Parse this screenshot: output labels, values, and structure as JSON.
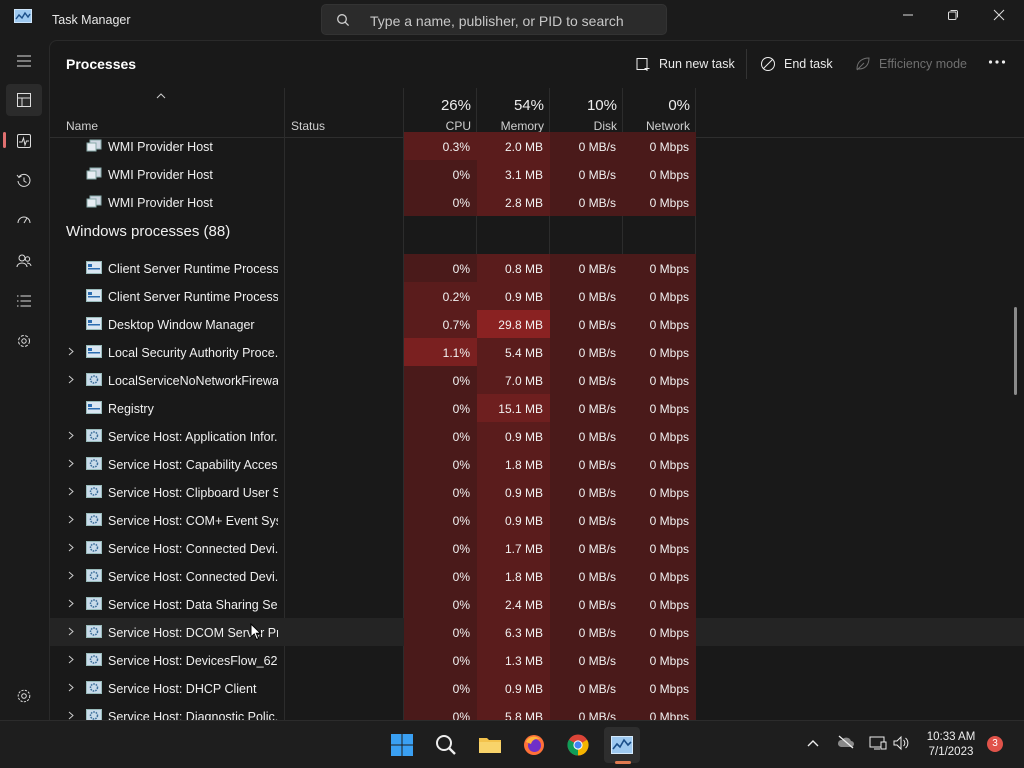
{
  "window": {
    "title": "Task Manager",
    "search_placeholder": "Type a name, publisher, or PID to search"
  },
  "page": {
    "title": "Processes",
    "commands": {
      "run_new_task": "Run new task",
      "end_task": "End task",
      "efficiency_mode": "Efficiency mode"
    }
  },
  "columns": {
    "name": "Name",
    "status": "Status",
    "cpu": {
      "pct": "26%",
      "label": "CPU"
    },
    "memory": {
      "pct": "54%",
      "label": "Memory"
    },
    "disk": {
      "pct": "10%",
      "label": "Disk"
    },
    "network": {
      "pct": "0%",
      "label": "Network"
    }
  },
  "processes_top": [
    {
      "name": "WMI Provider Host",
      "cpu": "0.3%",
      "memory": "2.0 MB",
      "disk": "0 MB/s",
      "network": "0 Mbps"
    },
    {
      "name": "WMI Provider Host",
      "cpu": "0%",
      "memory": "3.1 MB",
      "disk": "0 MB/s",
      "network": "0 Mbps"
    },
    {
      "name": "WMI Provider Host",
      "cpu": "0%",
      "memory": "2.8 MB",
      "disk": "0 MB/s",
      "network": "0 Mbps"
    }
  ],
  "group": {
    "title": "Windows processes (88)"
  },
  "windows_processes": [
    {
      "name": "Client Server Runtime Process",
      "cpu": "0%",
      "memory": "0.8 MB",
      "disk": "0 MB/s",
      "network": "0 Mbps"
    },
    {
      "name": "Client Server Runtime Process",
      "cpu": "0.2%",
      "memory": "0.9 MB",
      "disk": "0 MB/s",
      "network": "0 Mbps"
    },
    {
      "name": "Desktop Window Manager",
      "cpu": "0.7%",
      "memory": "29.8 MB",
      "disk": "0 MB/s",
      "network": "0 Mbps"
    },
    {
      "name": "Local Security Authority Proce...",
      "cpu": "1.1%",
      "memory": "5.4 MB",
      "disk": "0 MB/s",
      "network": "0 Mbps"
    },
    {
      "name": "LocalServiceNoNetworkFirewa...",
      "cpu": "0%",
      "memory": "7.0 MB",
      "disk": "0 MB/s",
      "network": "0 Mbps"
    },
    {
      "name": "Registry",
      "cpu": "0%",
      "memory": "15.1 MB",
      "disk": "0 MB/s",
      "network": "0 Mbps"
    },
    {
      "name": "Service Host: Application Infor...",
      "cpu": "0%",
      "memory": "0.9 MB",
      "disk": "0 MB/s",
      "network": "0 Mbps"
    },
    {
      "name": "Service Host: Capability Acces...",
      "cpu": "0%",
      "memory": "1.8 MB",
      "disk": "0 MB/s",
      "network": "0 Mbps"
    },
    {
      "name": "Service Host: Clipboard User S...",
      "cpu": "0%",
      "memory": "0.9 MB",
      "disk": "0 MB/s",
      "network": "0 Mbps"
    },
    {
      "name": "Service Host: COM+ Event Sys...",
      "cpu": "0%",
      "memory": "0.9 MB",
      "disk": "0 MB/s",
      "network": "0 Mbps"
    },
    {
      "name": "Service Host: Connected Devi...",
      "cpu": "0%",
      "memory": "1.7 MB",
      "disk": "0 MB/s",
      "network": "0 Mbps"
    },
    {
      "name": "Service Host: Connected Devi...",
      "cpu": "0%",
      "memory": "1.8 MB",
      "disk": "0 MB/s",
      "network": "0 Mbps"
    },
    {
      "name": "Service Host: Data Sharing Ser...",
      "cpu": "0%",
      "memory": "2.4 MB",
      "disk": "0 MB/s",
      "network": "0 Mbps"
    },
    {
      "name": "Service Host: DCOM Server Pr...",
      "cpu": "0%",
      "memory": "6.3 MB",
      "disk": "0 MB/s",
      "network": "0 Mbps"
    },
    {
      "name": "Service Host: DevicesFlow_621...",
      "cpu": "0%",
      "memory": "1.3 MB",
      "disk": "0 MB/s",
      "network": "0 Mbps"
    },
    {
      "name": "Service Host: DHCP Client",
      "cpu": "0%",
      "memory": "0.9 MB",
      "disk": "0 MB/s",
      "network": "0 Mbps"
    },
    {
      "name": "Service Host: Diagnostic Polic...",
      "cpu": "0%",
      "memory": "5.8 MB",
      "disk": "0 MB/s",
      "network": "0 Mbps"
    }
  ],
  "taskbar": {
    "time": "10:33 AM",
    "date": "7/1/2023",
    "notification_count": "3"
  },
  "colors": {
    "heat_low": "#4a1a1a",
    "heat_mid": "#6e1f1f",
    "heat_high": "#8a2222"
  }
}
